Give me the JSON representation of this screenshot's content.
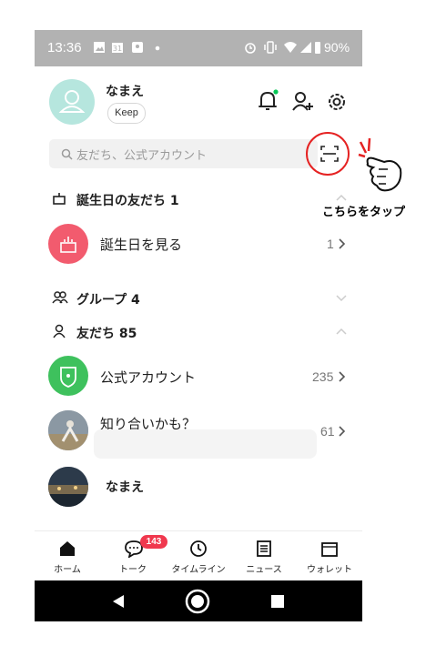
{
  "status_bar": {
    "time": "13:36",
    "battery": "90%"
  },
  "profile": {
    "name": "なまえ",
    "keep_label": "Keep"
  },
  "search": {
    "placeholder": "友だち、公式アカウント"
  },
  "sections": {
    "birthday": {
      "title": "誕生日の友だち 1",
      "item_label": "誕生日を見る",
      "item_count": "1"
    },
    "groups": {
      "title": "グループ 4"
    },
    "friends": {
      "title": "友だち 85"
    }
  },
  "friends_list": [
    {
      "label": "公式アカウント",
      "count": "235"
    },
    {
      "label": "知り合いかも？",
      "count": "61"
    },
    {
      "label": "なまえ",
      "count": ""
    }
  ],
  "annotation": {
    "text": "こちらをタップ"
  },
  "bottom_nav": {
    "items": [
      {
        "label": "ホーム"
      },
      {
        "label": "トーク"
      },
      {
        "label": "タイムライン"
      },
      {
        "label": "ニュース"
      },
      {
        "label": "ウォレット"
      }
    ],
    "talk_badge": "143"
  },
  "colors": {
    "accent_green": "#06c755",
    "badge_red": "#f0384e",
    "birthday_pink": "#f25b6e",
    "avatar_mint": "#b6e6de"
  }
}
